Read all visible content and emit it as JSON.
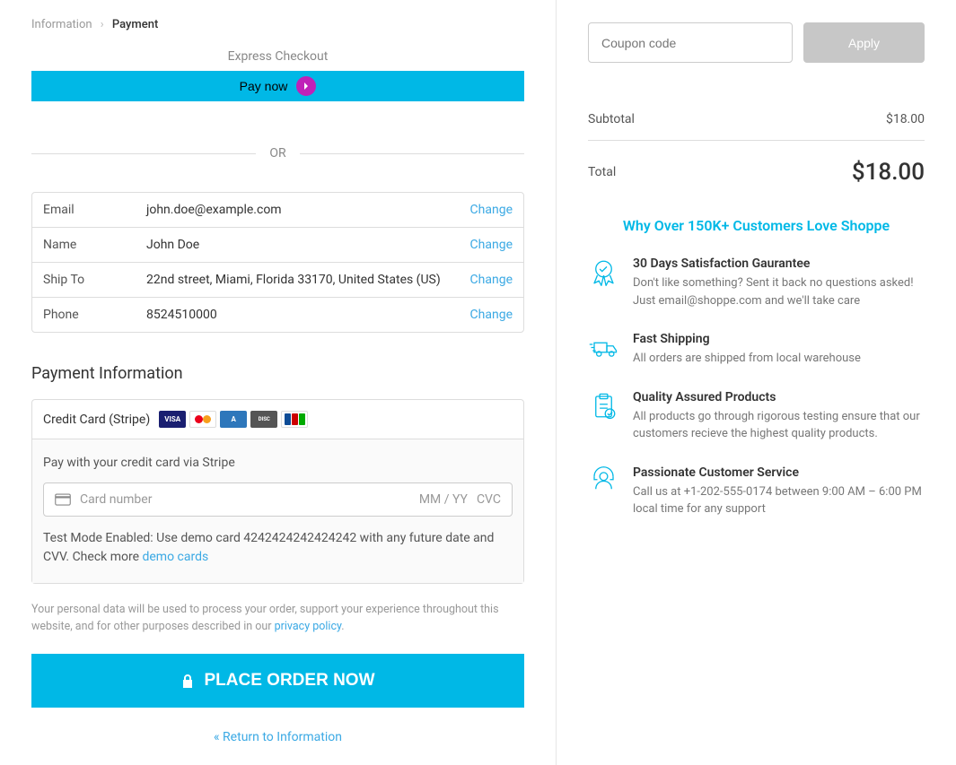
{
  "breadcrumb": {
    "info": "Information",
    "payment": "Payment"
  },
  "express": {
    "label": "Express Checkout",
    "button": "Pay now"
  },
  "or": "OR",
  "info": {
    "email_label": "Email",
    "email_value": "john.doe@example.com",
    "name_label": "Name",
    "name_value": "John Doe",
    "shipto_label": "Ship To",
    "shipto_value": "22nd street, Miami, Florida 33170, United States (US)",
    "phone_label": "Phone",
    "phone_value": "8524510000",
    "change": "Change"
  },
  "payment": {
    "title": "Payment Information",
    "method": "Credit Card (Stripe)",
    "desc": "Pay with your credit card via Stripe",
    "card_placeholder": "Card number",
    "card_expiry": "MM / YY",
    "card_cvc": "CVC",
    "test_note": "Test Mode Enabled: Use demo card 4242424242424242 with any future date and CVV. Check more ",
    "demo_link": "demo cards"
  },
  "privacy": {
    "text": "Your personal data will be used to process your order, support your experience throughout this website, and for other purposes described in our ",
    "link": "privacy policy"
  },
  "place_order": "PLACE ORDER NOW",
  "return_link": "« Return to Information",
  "coupon": {
    "placeholder": "Coupon code",
    "apply": "Apply"
  },
  "summary": {
    "subtotal_label": "Subtotal",
    "subtotal_value": "$18.00",
    "total_label": "Total",
    "total_value": "$18.00"
  },
  "trust": {
    "title": "Why Over 150K+ Customers Love Shoppe",
    "items": [
      {
        "title": "30 Days Satisfaction Gaurantee",
        "desc": "Don't like something? Sent it back no questions asked! Just email@shoppe.com and we'll take care"
      },
      {
        "title": "Fast Shipping",
        "desc": "All orders are shipped from local warehouse"
      },
      {
        "title": "Quality Assured Products",
        "desc": "All products go through rigorous testing ensure that our customers recieve the highest quality products."
      },
      {
        "title": "Passionate Customer Service",
        "desc": "Call us at +1-202-555-0174 between 9:00 AM – 6:00 PM local time for any support"
      }
    ]
  }
}
